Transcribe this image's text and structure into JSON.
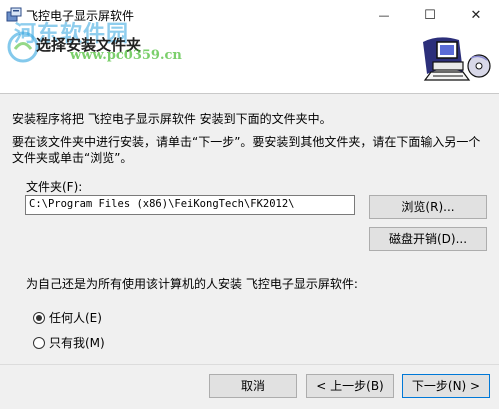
{
  "window": {
    "title": "飞控电子显示屏软件",
    "minimize_glyph": "—",
    "maximize_glyph": "☐",
    "close_glyph": "✕"
  },
  "header": {
    "title": "选择安装文件夹",
    "watermark_name": "河东软件园",
    "watermark_url": "www.pc0359.cn"
  },
  "content": {
    "intro": "安装程序将把 飞控电子显示屏软件 安装到下面的文件夹中。",
    "instructions": "要在该文件夹中进行安装，请单击“下一步”。要安装到其他文件夹，请在下面输入另一个文件夹或单击“浏览”。",
    "folder_label": "文件夹(F):",
    "folder_value": "C:\\Program Files (x86)\\FeiKongTech\\FK2012\\",
    "browse_button": "浏览(R)...",
    "disk_cost_button": "磁盘开销(D)...",
    "install_for_label": "为自己还是为所有使用该计算机的人安装 飞控电子显示屏软件:",
    "radio_everyone": "任何人(E)",
    "radio_just_me": "只有我(M)",
    "selected": "everyone"
  },
  "footer": {
    "cancel_button": "取消",
    "back_button": "< 上一步(B)",
    "next_button": "下一步(N) >"
  },
  "colors": {
    "accent": "#0078d7",
    "watermark_blue": "#33a6e0",
    "watermark_green": "#4fbf3a"
  },
  "icons": [
    "setup-app-icon",
    "computer-disk-illustration",
    "watermark-logo-icon"
  ]
}
